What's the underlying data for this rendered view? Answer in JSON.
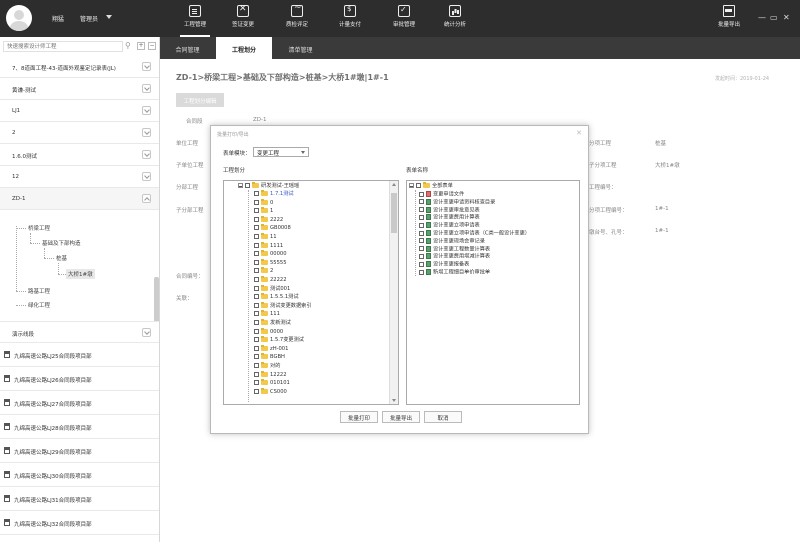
{
  "header": {
    "user_name": "翔猛",
    "role": "管理员",
    "nav": [
      {
        "label": "工程管理",
        "icon": "document-icon"
      },
      {
        "label": "签证变更",
        "icon": "x-icon"
      },
      {
        "label": "质检评定",
        "icon": "monitor-icon"
      },
      {
        "label": "计量支付",
        "icon": "bag-icon"
      },
      {
        "label": "审批管理",
        "icon": "calendar-check-icon"
      },
      {
        "label": "统计分析",
        "icon": "chart-icon"
      }
    ],
    "export_label": "批量导出"
  },
  "sidebar": {
    "search_placeholder": "快速搜索设计师工程",
    "items": [
      {
        "label": "7、8道面工程-43-道面外观鉴定记录表(JL)"
      },
      {
        "label": "黄谦-测试"
      },
      {
        "label": "LJ1"
      },
      {
        "label": "2"
      },
      {
        "label": "1.6.0测试"
      },
      {
        "label": "12"
      },
      {
        "label": "ZD-1"
      }
    ],
    "tree": {
      "n1": "桥梁工程",
      "n2": "基础及下部构造",
      "n3": "桩基",
      "n4": "大桥1#墩",
      "n5": "路基工程",
      "n6": "绿化工程"
    },
    "section_label": "演示线段",
    "projects": [
      {
        "label": "九绵高速公路LJ25合同段项目部"
      },
      {
        "label": "九绵高速公路LJ26合同段项目部"
      },
      {
        "label": "九绵高速公路LJ27合同段项目部"
      },
      {
        "label": "九绵高速公路LJ28合同段项目部"
      },
      {
        "label": "九绵高速公路LJ29合同段项目部"
      },
      {
        "label": "九绵高速公路LJ30合同段项目部"
      },
      {
        "label": "九绵高速公路LJ31合同段项目部"
      },
      {
        "label": "九绵高速公路LJ32合同段项目部"
      }
    ]
  },
  "main": {
    "tabs": [
      {
        "label": "合同管理"
      },
      {
        "label": "工程划分"
      },
      {
        "label": "清单管理"
      }
    ],
    "breadcrumb": "ZD-1>桥梁工程>基础及下部构造>桩基>大桥1#墩|1#-1",
    "date": "发起时间：2019-01-24",
    "edit_button": "工程划分编辑",
    "fields": {
      "contract_label": "合同段",
      "contract_value": "ZD-1",
      "unit_label": "单位工程",
      "subunit_label": "子单位工程",
      "part_label": "分部工程",
      "subpart_label": "子分部工程",
      "item_label": "分项工程",
      "item_value": "桩基",
      "sub_label": "子分项工程",
      "sub_value": "大桥1#墩",
      "code_label": "工程编号：",
      "no_label": "分项工程编号：",
      "no_value": "1#-1",
      "pier_label": "墩台号、孔号：",
      "pier_value": "1#-1",
      "contract_no_label": "合同编号：",
      "remark_label": "关联："
    }
  },
  "dialog": {
    "title": "批量打印/导出",
    "form_type_label": "表单模块：",
    "form_type_value": "变更工程",
    "left_heading": "工程划分",
    "right_heading": "表单名称",
    "left_root": "研发测试-王瑶瑶",
    "left_items": [
      "1.7.1测试",
      "0",
      "1",
      "2222",
      "GB0008",
      "11",
      "1111",
      "00000",
      "55555",
      "2",
      "22222",
      "测试001",
      "1.5.5.1测试",
      "测试变更数据索引",
      "111",
      "发新测试",
      "0000",
      "1.5.7变更测试",
      "zH-001",
      "BGBH",
      "对的",
      "12222",
      "010101",
      "CS000"
    ],
    "right_root": "全部表单",
    "right_items": [
      "变更申请文件",
      "设计变更申请资料核查目录",
      "设计变更审批意见表",
      "设计变更费用计算表",
      "设计变更立项申请表",
      "设计变更立项申请表（C类一般设计变更）",
      "设计变更现场会审记录",
      "设计变更工程数量计算表",
      "设计变更费用增减计算表",
      "设计变更报备表",
      "新增工程细目单价审批单"
    ],
    "buttons": {
      "print": "批量打印",
      "export": "批量导出",
      "cancel": "取消"
    }
  }
}
